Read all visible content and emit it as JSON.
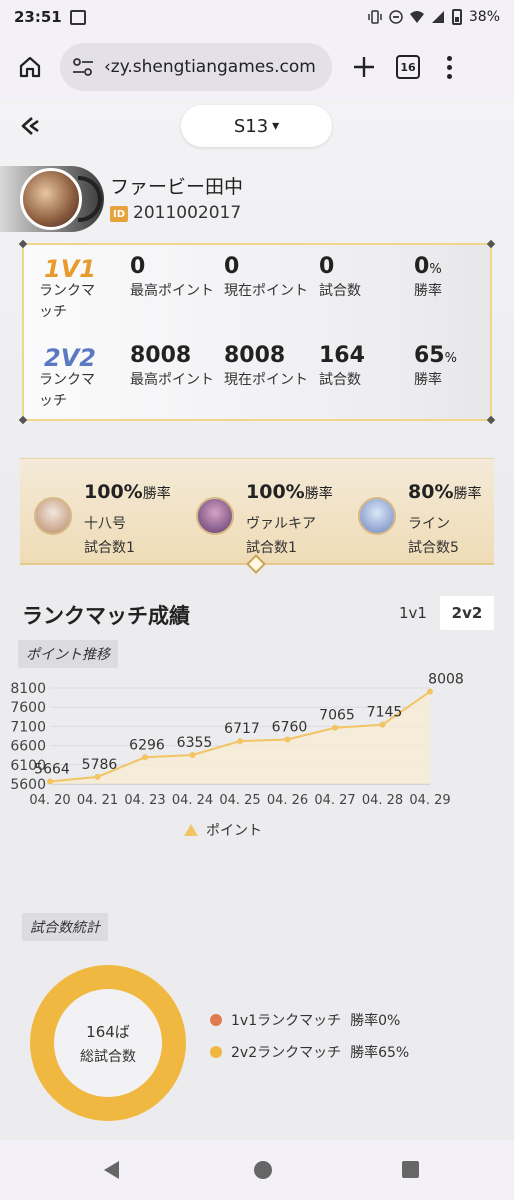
{
  "status": {
    "time": "23:51",
    "battery": "38%"
  },
  "browser": {
    "url": "‹zy.shengtiangames.com",
    "tab_count": "16"
  },
  "header": {
    "season": "S13",
    "caret": "▾"
  },
  "player": {
    "name": "ファービー田中",
    "id_label": "ID",
    "id": "2011002017"
  },
  "modes": [
    {
      "mode": "1V1",
      "label": "ランクマッチ",
      "max_points": "0",
      "max_points_label": "最高ポイント",
      "current_points": "0",
      "current_points_label": "現在ポイント",
      "matches": "0",
      "matches_label": "試合数",
      "win_rate": "0",
      "win_rate_unit": "%",
      "win_rate_label": "勝率"
    },
    {
      "mode": "2V2",
      "label": "ランクマッチ",
      "max_points": "8008",
      "max_points_label": "最高ポイント",
      "current_points": "8008",
      "current_points_label": "現在ポイント",
      "matches": "164",
      "matches_label": "試合数",
      "win_rate": "65",
      "win_rate_unit": "%",
      "win_rate_label": "勝率"
    }
  ],
  "heroes": [
    {
      "rate": "100%",
      "rate_label": "勝率",
      "name": "十八号",
      "games": "試合数1"
    },
    {
      "rate": "100%",
      "rate_label": "勝率",
      "name": "ヴァルキア",
      "games": "試合数1"
    },
    {
      "rate": "80%",
      "rate_label": "勝率",
      "name": "ライン",
      "games": "試合数5"
    }
  ],
  "rank": {
    "title": "ランクマッチ成績",
    "tabs": [
      "1v1",
      "2v2"
    ],
    "active_tab": "2v2",
    "points_tag": "ポイント推移",
    "legend": "ポイント"
  },
  "chart_data": {
    "type": "line",
    "categories": [
      "04. 20",
      "04. 21",
      "04. 23",
      "04. 24",
      "04. 25",
      "04. 26",
      "04. 27",
      "04. 28",
      "04. 29"
    ],
    "series": [
      {
        "name": "ポイント",
        "values": [
          5664,
          5786,
          6296,
          6355,
          6717,
          6760,
          7065,
          7145,
          8008
        ]
      }
    ],
    "yticks": [
      "8100",
      "7600",
      "7100",
      "6600",
      "6100",
      "5600"
    ],
    "ylim": [
      5600,
      8100
    ],
    "line_color": "#f2c463",
    "area_color": "#faecd0"
  },
  "match_stats": {
    "tag": "試合数統計",
    "total": "164ば",
    "total_label": "総試合数",
    "items": [
      {
        "label": "1v1ランクマッチ",
        "rate": "勝率0%",
        "color": "#e07b4f"
      },
      {
        "label": "2v2ランクマッチ",
        "rate": "勝率65%",
        "color": "#f0b840"
      }
    ]
  }
}
